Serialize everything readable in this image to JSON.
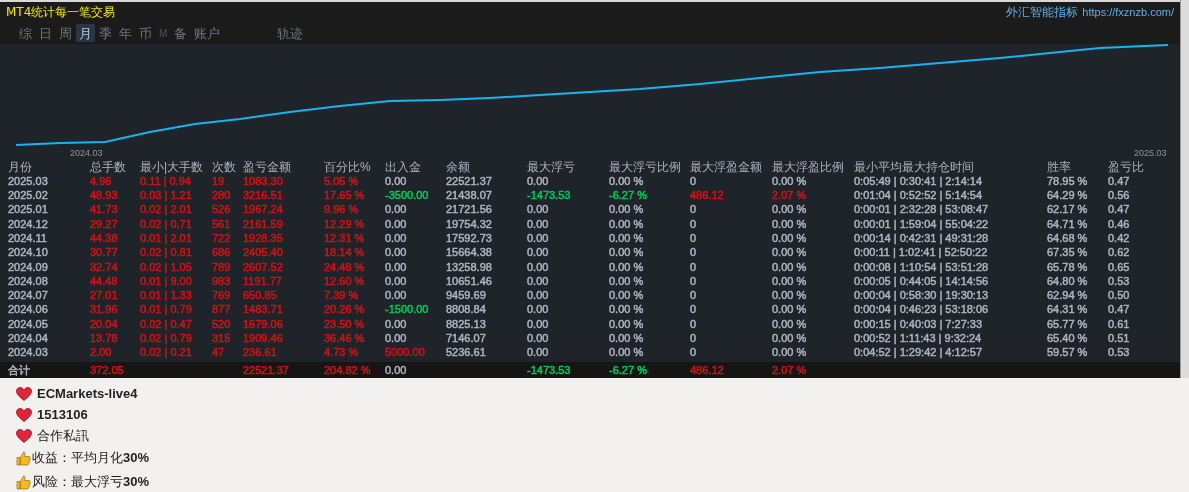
{
  "window": {
    "title": "MT4统计每一笔交易",
    "brand": "外汇智能指标",
    "url": "https://fxznzb.com/"
  },
  "tabs": [
    {
      "label": "综",
      "selected": false,
      "dim": false
    },
    {
      "label": "日",
      "selected": false,
      "dim": false
    },
    {
      "label": "周",
      "selected": false,
      "dim": false
    },
    {
      "label": "月",
      "selected": true,
      "dim": false
    },
    {
      "label": "季",
      "selected": false,
      "dim": false
    },
    {
      "label": "年",
      "selected": false,
      "dim": false
    },
    {
      "label": "币",
      "selected": false,
      "dim": false
    },
    {
      "label": "M",
      "selected": false,
      "dim": true
    },
    {
      "label": "备",
      "selected": false,
      "dim": false
    },
    {
      "label": "账户",
      "selected": false,
      "dim": false
    },
    {
      "label": "轨迹",
      "selected": false,
      "dim": false
    }
  ],
  "chart": {
    "x_labels": [
      "2024.03",
      "2025.03"
    ]
  },
  "table": {
    "columns": [
      {
        "label": "月份",
        "color": "#aab3bf"
      },
      {
        "label": "总手数",
        "color": "#d41212"
      },
      {
        "label": "最小|大手数",
        "color": "#d41212"
      },
      {
        "label": "次数",
        "color": "#d41212"
      },
      {
        "label": "盈亏金额",
        "color": "#d41212"
      },
      {
        "label": "百分比%",
        "color": "#d41212"
      },
      {
        "label": "出入金",
        "color": "#aab3bf"
      },
      {
        "label": "余额",
        "color": "#aab3bf"
      },
      {
        "label": "最大浮亏",
        "color": "#aab3bf"
      },
      {
        "label": "最大浮亏比例",
        "color": "#aab3bf"
      },
      {
        "label": "最大浮盈金额",
        "color": "#aab3bf"
      },
      {
        "label": "最大浮盈比例",
        "color": "#aab3bf"
      },
      {
        "label": "最小平均最大持仓时间",
        "color": "#aab3bf"
      },
      {
        "label": "胜率",
        "color": "#aab3bf"
      },
      {
        "label": "盈亏比",
        "color": "#aab3bf"
      }
    ],
    "rows": [
      [
        "2025.03",
        "4.96",
        "0.11 | 0.94",
        "19",
        "1083.30",
        "5.05 %",
        "0.00",
        "22521.37",
        "0.00",
        "0.00 %",
        "0",
        "0.00 %",
        "0:05:49 | 0:30:41 | 2:14:14",
        "78.95 %",
        "0.47"
      ],
      [
        "2025.02",
        "48.93",
        "0.03 | 1.21",
        "280",
        "3216.51",
        "17.65 %",
        {
          "text": "-3500.00",
          "color": "#00c853"
        },
        "21438.07",
        {
          "text": "-1473.53",
          "color": "#00c853"
        },
        {
          "text": "-6.27 %",
          "color": "#00c853"
        },
        {
          "text": "486.12",
          "color": "#d41212"
        },
        {
          "text": "2.07 %",
          "color": "#d41212"
        },
        "0:01:04 | 0:52:52 | 5:14:54",
        "64.29 %",
        "0.56"
      ],
      [
        "2025.01",
        "41.73",
        "0.02 | 2.01",
        "526",
        "1967.24",
        "9.96 %",
        "0.00",
        "21721.56",
        "0.00",
        "0.00 %",
        "0",
        "0.00 %",
        "0:00:01 | 2:32:28 | 53:08:47",
        "62.17 %",
        "0.47"
      ],
      [
        "2024.12",
        "29.27",
        "0.02 | 0.71",
        "561",
        "2161.59",
        "12.29 %",
        "0.00",
        "19754.32",
        "0.00",
        "0.00 %",
        "0",
        "0.00 %",
        "0:00:01 | 1:59:04 | 55:04:22",
        "64.71 %",
        "0.46"
      ],
      [
        "2024.11",
        "44.38",
        "0.01 | 2.01",
        "722",
        "1928.35",
        "12.31 %",
        "0.00",
        "17592.73",
        "0.00",
        "0.00 %",
        "0",
        "0.00 %",
        "0:00:14 | 0:42:31 | 49:31:28",
        "64.68 %",
        "0.42"
      ],
      [
        "2024.10",
        "30.77",
        "0.02 | 0.81",
        "686",
        "2405.40",
        "18.14 %",
        "0.00",
        "15664.38",
        "0.00",
        "0.00 %",
        "0",
        "0.00 %",
        "0:00:11 | 1:02:41 | 52:50:22",
        "67.35 %",
        "0.62"
      ],
      [
        "2024.09",
        "32.74",
        "0.02 | 1.05",
        "789",
        "2607.52",
        "24.48 %",
        "0.00",
        "13258.98",
        "0.00",
        "0.00 %",
        "0",
        "0.00 %",
        "0:00:08 | 1:10:54 | 53:51:28",
        "65.78 %",
        "0.65"
      ],
      [
        "2024.08",
        "44.48",
        "0.01 | 9.00",
        "983",
        "1191.77",
        "12.60 %",
        "0.00",
        "10651.46",
        "0.00",
        "0.00 %",
        "0",
        "0.00 %",
        "0:00:05 | 0:44:05 | 14:14:56",
        "64.80 %",
        "0.53"
      ],
      [
        "2024.07",
        "27.01",
        "0.01 | 1.33",
        "769",
        "650.85",
        "7.39 %",
        "0.00",
        "9459.69",
        "0.00",
        "0.00 %",
        "0",
        "0.00 %",
        "0:00:04 | 0:58:30 | 19:30:13",
        "62.94 %",
        "0.50"
      ],
      [
        "2024.06",
        "31.96",
        "0.01 | 0.79",
        "877",
        "1483.71",
        "20.26 %",
        {
          "text": "-1500.00",
          "color": "#00c853"
        },
        "8808.84",
        "0.00",
        "0.00 %",
        "0",
        "0.00 %",
        "0:00:04 | 0:46:23 | 53:18:06",
        "64.31 %",
        "0.47"
      ],
      [
        "2024.05",
        "20.04",
        "0.02 | 0.47",
        "520",
        "1679.06",
        "23.50 %",
        "0.00",
        "8825.13",
        "0.00",
        "0.00 %",
        "0",
        "0.00 %",
        "0:00:15 | 0:40:03 | 7:27:33",
        "65.77 %",
        "0.61"
      ],
      [
        "2024.04",
        "13.78",
        "0.02 | 0.79",
        "315",
        "1909.46",
        "36.46 %",
        "0.00",
        "7146.07",
        "0.00",
        "0.00 %",
        "0",
        "0.00 %",
        "0:00:52 | 1:11:43 | 9:32:24",
        "65.40 %",
        "0.51"
      ],
      [
        "2024.03",
        "2.00",
        "0.02 | 0.21",
        "47",
        "236.61",
        "4.73 %",
        {
          "text": "5000.00",
          "color": "#d41212"
        },
        "5236.61",
        "0.00",
        "0.00 %",
        "0",
        "0.00 %",
        "0:04:52 | 1:29:42 | 4:12:57",
        "59.57 %",
        "0.53"
      ]
    ],
    "total": [
      "合计",
      "372.05",
      "22521.37",
      "204.82 %",
      "0.00",
      {
        "text": "-1473.53",
        "color": "#00c853"
      },
      {
        "text": "-6.27 %",
        "color": "#00c853"
      },
      {
        "text": "486.12",
        "color": "#d41212"
      },
      {
        "text": "2.07 %",
        "color": "#d41212"
      }
    ]
  },
  "notes": [
    {
      "kind": "heart",
      "text": "ECMarkets-live4",
      "bold": true
    },
    {
      "kind": "heart",
      "text": "1513106",
      "bold": true
    },
    {
      "kind": "heart",
      "text": "合作私訊",
      "bold": false
    },
    {
      "kind": "thumb",
      "text": "收益：平均月化**30%**",
      "bold": false
    },
    {
      "kind": "thumb",
      "text": "风险：最大浮亏**30%**",
      "bold": false
    }
  ]
}
